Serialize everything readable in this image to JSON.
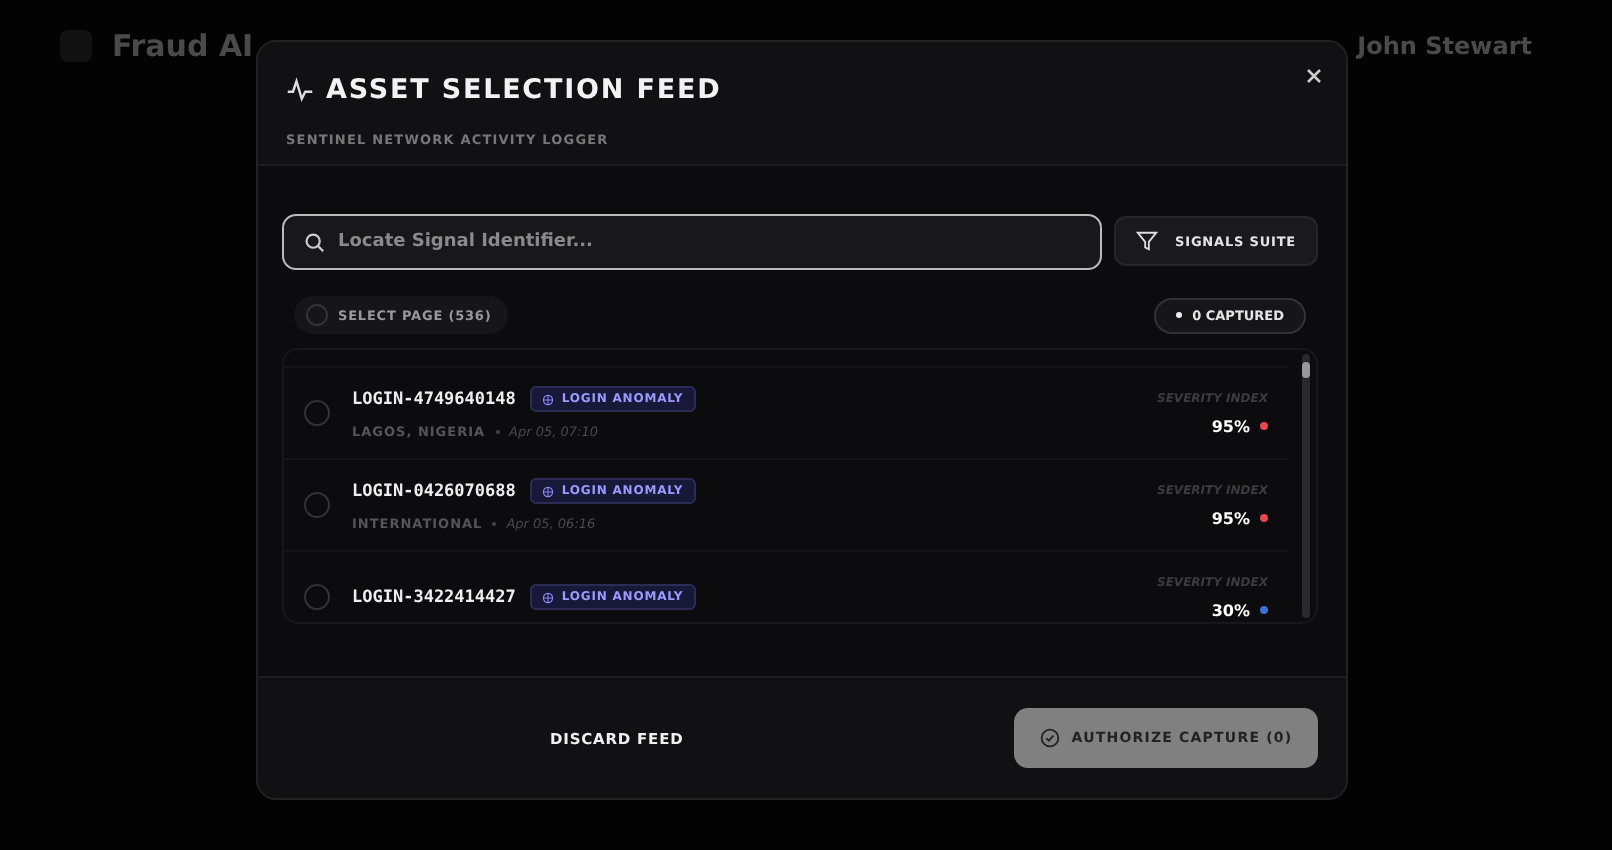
{
  "background": {
    "app_name": "Fraud AI",
    "user_name": "John Stewart"
  },
  "modal": {
    "title": "ASSET SELECTION FEED",
    "subtitle": "SENTINEL NETWORK ACTIVITY LOGGER",
    "search": {
      "placeholder": "Locate Signal Identifier..."
    },
    "filter_button": "SIGNALS SUITE",
    "select_page": {
      "label": "SELECT PAGE (536)",
      "checked": false
    },
    "captured_badge": "0 CAPTURED",
    "rows": [
      {
        "id": "LOGIN-4749640148",
        "tag": "LOGIN ANOMALY",
        "location": "LAGOS, NIGERIA",
        "time": "Apr 05, 07:10",
        "severity_label": "SEVERITY INDEX",
        "severity": "95%",
        "color": "#e5484d",
        "selected": false
      },
      {
        "id": "LOGIN-0426070688",
        "tag": "LOGIN ANOMALY",
        "location": "INTERNATIONAL",
        "time": "Apr 05, 06:16",
        "severity_label": "SEVERITY INDEX",
        "severity": "95%",
        "color": "#e5484d",
        "selected": false
      },
      {
        "id": "LOGIN-3422414427",
        "tag": "LOGIN ANOMALY",
        "severity_label": "SEVERITY INDEX",
        "severity": "30%",
        "color": "#3b6fd6",
        "selected": false
      }
    ],
    "discard_button": "DISCARD FEED",
    "authorize_button": "AUTHORIZE CAPTURE (0)"
  }
}
